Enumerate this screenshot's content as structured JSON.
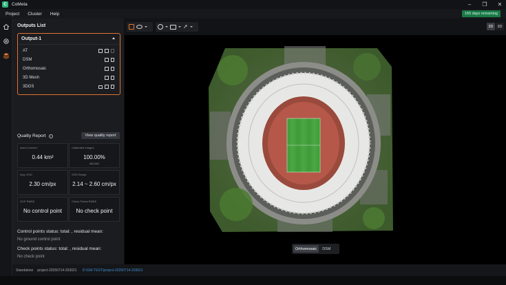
{
  "app": {
    "title": "CoMeta",
    "logo_letter": "C"
  },
  "menu": {
    "items": [
      "Project",
      "Cluster",
      "Help"
    ]
  },
  "license": {
    "label": "165 days remaining"
  },
  "outputs": {
    "title": "Outputs List",
    "group_label": "Output-1",
    "rows": [
      {
        "label": "AT"
      },
      {
        "label": "DSM"
      },
      {
        "label": "Orthomosaic"
      },
      {
        "label": "3D Mesh"
      },
      {
        "label": "3DGS"
      }
    ]
  },
  "quality": {
    "title": "Quality Report",
    "button_label": "View quality report",
    "cards": [
      {
        "label": "Area Covered",
        "value": "0.44 km²",
        "sub": ""
      },
      {
        "label": "Calibrated Images",
        "value": "100.00%",
        "sub": "461/461"
      },
      {
        "label": "Avg. GSD",
        "value": "2.30 cm/px",
        "sub": ""
      },
      {
        "label": "GSD Range",
        "value": "2.14 ~ 2.60 cm/px",
        "sub": ""
      },
      {
        "label": "GCP RMSE",
        "value": "No control point",
        "sub": ""
      },
      {
        "label": "Check Points RMSE",
        "value": "No check point",
        "sub": ""
      }
    ],
    "control_status": "Control points status: total: , residual mean:",
    "control_sub": "No ground control point",
    "check_status": "Check points status: total: , residual mean:",
    "check_sub": "No check point"
  },
  "statusbar": {
    "mode": "Standalone",
    "project": "project-20250714-203021",
    "path": "D:\\GW-TEST\\project-20250714-203021"
  },
  "viewer": {
    "view_2d": "2D",
    "view_3d": "3D",
    "layers": [
      "Orthomosaic",
      "DSM"
    ],
    "active_layer": "Orthomosaic",
    "active_view": "2D"
  },
  "colors": {
    "accent": "#e2752d",
    "license_bg": "#1a7a47",
    "link": "#3d8fd6"
  }
}
